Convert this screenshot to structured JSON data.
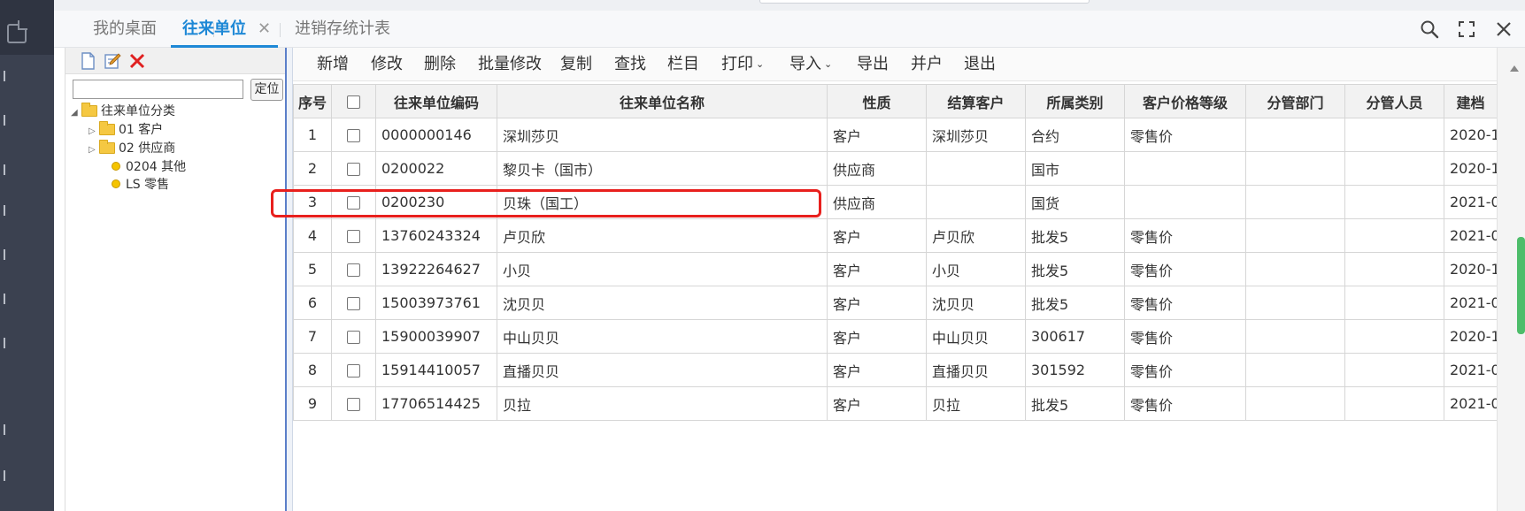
{
  "tabs": [
    {
      "label": "我的桌面"
    },
    {
      "label": "往来单位"
    },
    {
      "label": "进销存统计表"
    }
  ],
  "tab_close_glyph": "✕",
  "window_icons": [
    "search-icon",
    "fullscreen-icon",
    "close-icon"
  ],
  "tree": {
    "locate_label": "定位",
    "search_value": "",
    "toolbar_icons": [
      "new-doc-icon",
      "edit-icon",
      "delete-icon"
    ],
    "root": {
      "label": "往来单位分类",
      "caret": "◢"
    },
    "nodes": [
      {
        "label": "01 客户",
        "type": "folder",
        "caret": "▷"
      },
      {
        "label": "02 供应商",
        "type": "folder",
        "caret": "▷"
      },
      {
        "label": "0204 其他",
        "type": "leaf"
      },
      {
        "label": "LS 零售",
        "type": "leaf"
      }
    ]
  },
  "actions": [
    {
      "label": "新增"
    },
    {
      "label": "修改"
    },
    {
      "label": "删除"
    },
    {
      "label": "批量修改"
    },
    {
      "label": "复制"
    },
    {
      "label": "查找"
    },
    {
      "label": "栏目"
    },
    {
      "label": "打印",
      "dropdown": true
    },
    {
      "label": "导入",
      "dropdown": true
    },
    {
      "label": "导出"
    },
    {
      "label": "并户"
    },
    {
      "label": "退出"
    }
  ],
  "chevron_glyph": "⌄",
  "grid": {
    "columns": [
      "序号",
      "",
      "往来单位编码",
      "往来单位名称",
      "性质",
      "结算客户",
      "所属类别",
      "客户价格等级",
      "分管部门",
      "分管人员",
      "建档"
    ],
    "rows": [
      {
        "seq": "1",
        "code": "0000000146",
        "name": "深圳莎贝",
        "nature": "客户",
        "settle": "深圳莎贝",
        "category": "合约",
        "price_level": "零售价",
        "dept": "",
        "staff": "",
        "created": "2020-1"
      },
      {
        "seq": "2",
        "code": "0200022",
        "name": "黎贝卡（国市）",
        "nature": "供应商",
        "settle": "",
        "category": "国市",
        "price_level": "",
        "dept": "",
        "staff": "",
        "created": "2020-1"
      },
      {
        "seq": "3",
        "code": "0200230",
        "name": "贝珠（国工）",
        "nature": "供应商",
        "settle": "",
        "category": "国货",
        "price_level": "",
        "dept": "",
        "staff": "",
        "created": "2021-0"
      },
      {
        "seq": "4",
        "code": "13760243324",
        "name": "卢贝欣",
        "nature": "客户",
        "settle": "卢贝欣",
        "category": "批发5",
        "price_level": "零售价",
        "dept": "",
        "staff": "",
        "created": "2021-0"
      },
      {
        "seq": "5",
        "code": "13922264627",
        "name": "小贝",
        "nature": "客户",
        "settle": "小贝",
        "category": "批发5",
        "price_level": "零售价",
        "dept": "",
        "staff": "",
        "created": "2020-1"
      },
      {
        "seq": "6",
        "code": "15003973761",
        "name": "沈贝贝",
        "nature": "客户",
        "settle": "沈贝贝",
        "category": "批发5",
        "price_level": "零售价",
        "dept": "",
        "staff": "",
        "created": "2021-0"
      },
      {
        "seq": "7",
        "code": "15900039907",
        "name": "中山贝贝",
        "nature": "客户",
        "settle": "中山贝贝",
        "category": "300617",
        "price_level": "零售价",
        "dept": "",
        "staff": "",
        "created": "2020-1"
      },
      {
        "seq": "8",
        "code": "15914410057",
        "name": "直播贝贝",
        "nature": "客户",
        "settle": "直播贝贝",
        "category": "301592",
        "price_level": "零售价",
        "dept": "",
        "staff": "",
        "created": "2021-0"
      },
      {
        "seq": "9",
        "code": "17706514425",
        "name": "贝拉",
        "nature": "客户",
        "settle": "贝拉",
        "category": "批发5",
        "price_level": "零售价",
        "dept": "",
        "staff": "",
        "created": "2021-0"
      }
    ]
  },
  "colors": {
    "accent": "#1e88d6",
    "highlight": "#e8201d",
    "scroll_thumb": "#4dbd6a",
    "rail": "#3b4150"
  }
}
